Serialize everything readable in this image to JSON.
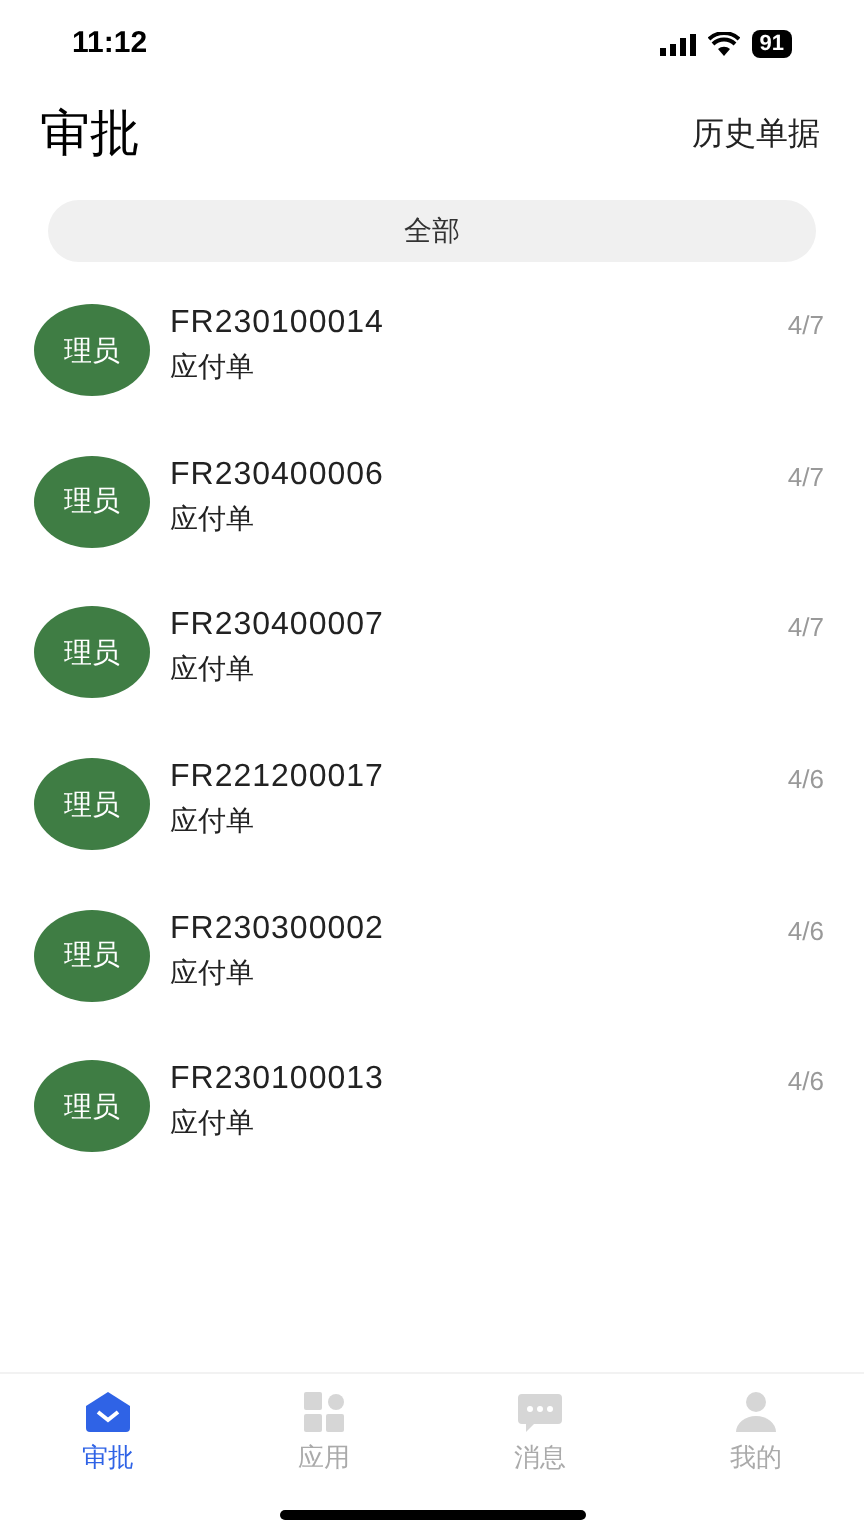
{
  "status_bar": {
    "time": "11:12",
    "battery": "91"
  },
  "header": {
    "title": "审批",
    "action": "历史单据"
  },
  "filter": {
    "label": "全部"
  },
  "items": [
    {
      "avatar": "理员",
      "number": "FR230100014",
      "type": "应付单",
      "date": "4/7"
    },
    {
      "avatar": "理员",
      "number": "FR230400006",
      "type": "应付单",
      "date": "4/7"
    },
    {
      "avatar": "理员",
      "number": "FR230400007",
      "type": "应付单",
      "date": "4/7"
    },
    {
      "avatar": "理员",
      "number": "FR221200017",
      "type": "应付单",
      "date": "4/6"
    },
    {
      "avatar": "理员",
      "number": "FR230300002",
      "type": "应付单",
      "date": "4/6"
    },
    {
      "avatar": "理员",
      "number": "FR230100013",
      "type": "应付单",
      "date": "4/6"
    }
  ],
  "tab_bar": [
    {
      "kind": "approval",
      "label": "审批",
      "selected": true
    },
    {
      "kind": "apps",
      "label": "应用",
      "selected": false
    },
    {
      "kind": "messages",
      "label": "消息",
      "selected": false
    },
    {
      "kind": "profile",
      "label": "我的",
      "selected": false
    }
  ]
}
